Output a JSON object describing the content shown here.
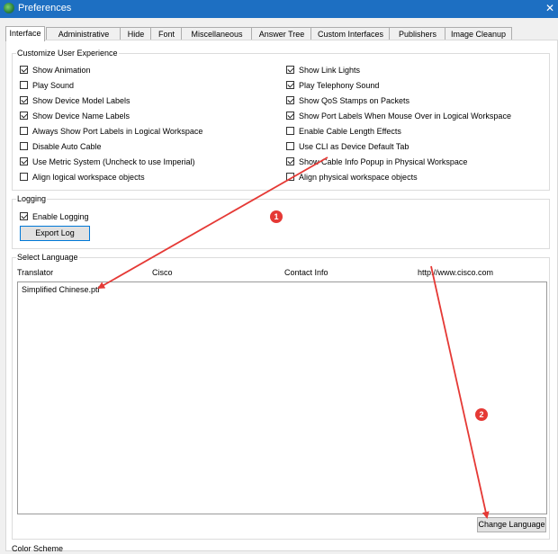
{
  "window": {
    "title": "Preferences",
    "close_glyph": "✕"
  },
  "tabs": [
    {
      "label": "Interface"
    },
    {
      "label": "Administrative"
    },
    {
      "label": "Hide"
    },
    {
      "label": "Font"
    },
    {
      "label": "Miscellaneous"
    },
    {
      "label": "Answer Tree"
    },
    {
      "label": "Custom Interfaces"
    },
    {
      "label": "Publishers"
    },
    {
      "label": "Image Cleanup"
    }
  ],
  "active_tab": "Interface",
  "customize": {
    "title": "Customize User Experience",
    "left": [
      {
        "label": "Show Animation",
        "checked": true
      },
      {
        "label": "Play Sound",
        "checked": false
      },
      {
        "label": "Show Device Model Labels",
        "checked": true
      },
      {
        "label": "Show Device Name Labels",
        "checked": true
      },
      {
        "label": "Always Show Port Labels in Logical Workspace",
        "checked": false
      },
      {
        "label": "Disable Auto Cable",
        "checked": false
      },
      {
        "label": "Use Metric System (Uncheck to use Imperial)",
        "checked": true
      },
      {
        "label": "Align logical workspace objects",
        "checked": false
      }
    ],
    "right": [
      {
        "label": "Show Link Lights",
        "checked": true
      },
      {
        "label": "Play Telephony Sound",
        "checked": true
      },
      {
        "label": "Show QoS Stamps on Packets",
        "checked": true
      },
      {
        "label": "Show Port Labels When Mouse Over in Logical Workspace",
        "checked": true
      },
      {
        "label": "Enable Cable Length Effects",
        "checked": false
      },
      {
        "label": "Use CLI as Device Default Tab",
        "checked": false
      },
      {
        "label": "Show Cable Info Popup in Physical Workspace",
        "checked": true
      },
      {
        "label": "Align physical workspace objects",
        "checked": false
      }
    ]
  },
  "logging": {
    "title": "Logging",
    "enable_label": "Enable Logging",
    "enable_checked": true,
    "export_label": "Export Log"
  },
  "language": {
    "title": "Select Language",
    "columns": [
      "Translator",
      "Cisco",
      "Contact Info",
      "http://www.cisco.com"
    ],
    "items": [
      "Simplified Chinese.ptl"
    ],
    "change_button": "Change Language"
  },
  "color_scheme": {
    "title": "Color Scheme"
  },
  "annotations": [
    {
      "label": "1"
    },
    {
      "label": "2"
    }
  ],
  "colors": {
    "titlebar": "#1d6fc2",
    "annotation": "#e53935"
  }
}
